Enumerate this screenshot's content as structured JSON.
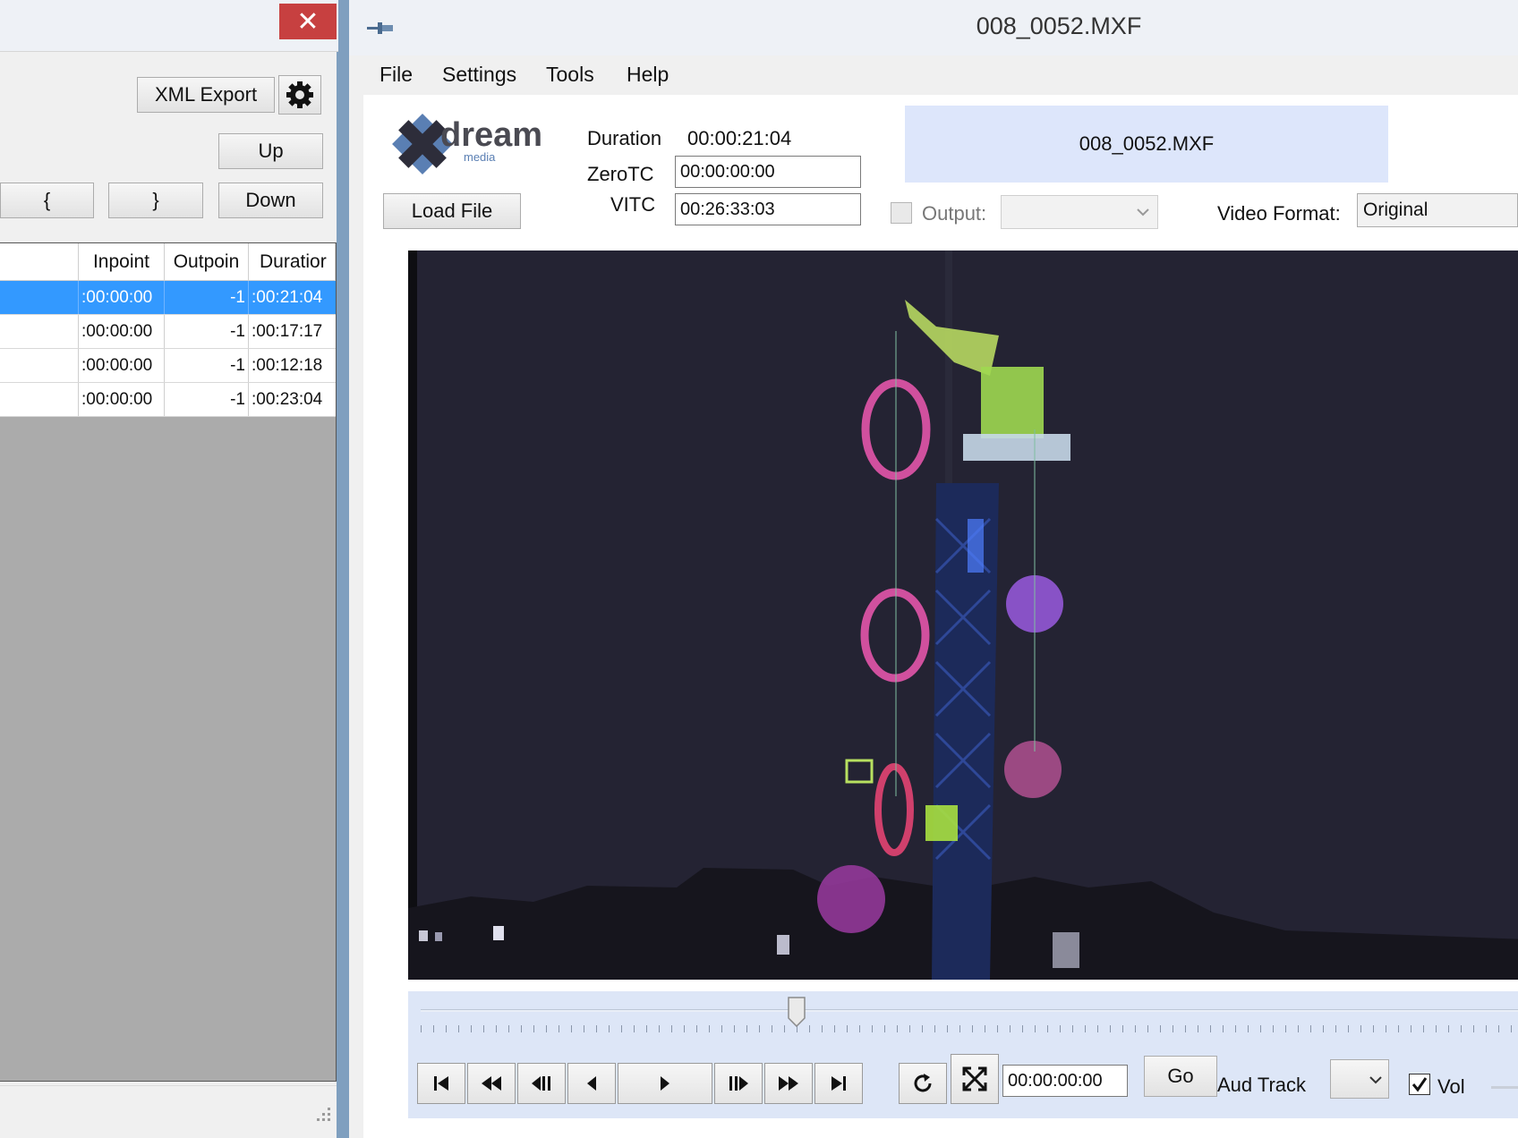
{
  "left_window": {
    "close_label": "✕",
    "xml_export_label": "XML Export",
    "up_label": "Up",
    "down_label": "Down",
    "brace_open_label": "{",
    "brace_close_label": "}",
    "columns": [
      "Inpoint",
      "Outpoin",
      "Duratior"
    ],
    "rows": [
      {
        "inpoint": ":00:00:00",
        "outpoint": "-1",
        "duration": ":00:21:04"
      },
      {
        "inpoint": ":00:00:00",
        "outpoint": "-1",
        "duration": ":00:17:17"
      },
      {
        "inpoint": ":00:00:00",
        "outpoint": "-1",
        "duration": ":00:12:18"
      },
      {
        "inpoint": ":00:00:00",
        "outpoint": "-1",
        "duration": ":00:23:04"
      }
    ]
  },
  "player": {
    "title": "008_0052.MXF",
    "menu": [
      "File",
      "Settings",
      "Tools",
      "Help"
    ],
    "logo_text": "dream",
    "logo_sub": "media",
    "load_file_label": "Load File",
    "duration_label": "Duration",
    "duration_value": "00:00:21:04",
    "zerotc_label": "ZeroTC",
    "zerotc_value": "00:00:00:00",
    "vitc_label": "VITC",
    "vitc_value": "00:26:33:03",
    "file_name": "008_0052.MXF",
    "output_label": "Output:",
    "output_checked": false,
    "video_format_label": "Video Format:",
    "video_format_value": "Original",
    "timecode_value": "00:00:00:00",
    "go_label": "Go",
    "aud_track_label": "Aud Track",
    "vol_label": "Vol",
    "vol_checked": true,
    "seek_position": 0.34
  }
}
